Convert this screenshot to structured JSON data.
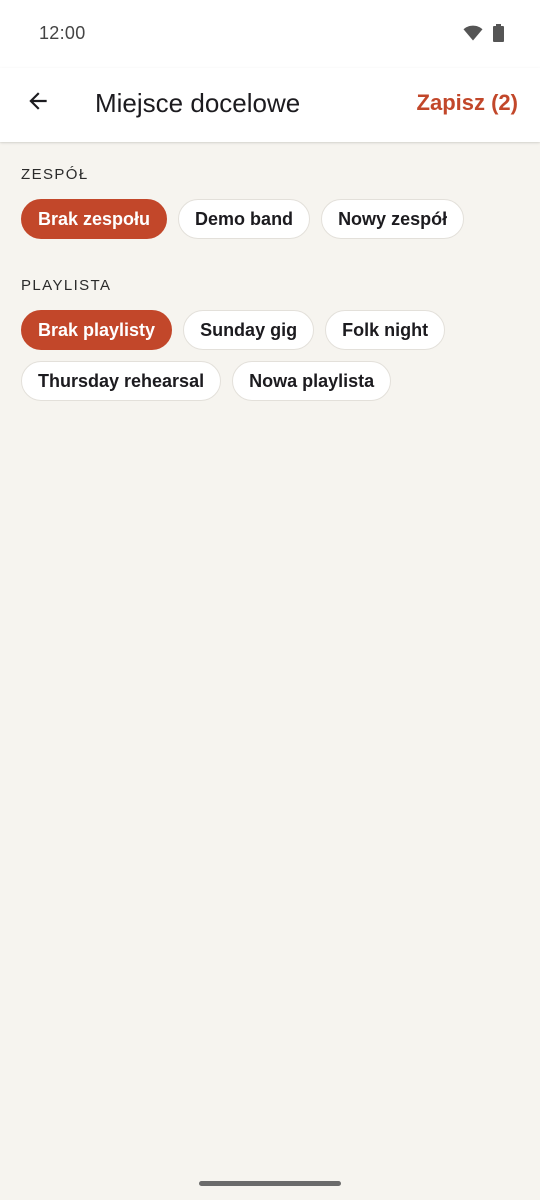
{
  "status_bar": {
    "time": "12:00",
    "icons": [
      "wifi-icon",
      "battery-icon"
    ]
  },
  "app_bar": {
    "back_icon": "arrow-left-icon",
    "title": "Miejsce docelowe",
    "save_label": "Zapisz (2)"
  },
  "colors": {
    "accent": "#c2472a",
    "background": "#f6f4ef",
    "surface": "#ffffff"
  },
  "sections": {
    "band": {
      "label": "ZESPÓŁ",
      "chips": [
        {
          "label": "Brak zespołu",
          "selected": true
        },
        {
          "label": "Demo band",
          "selected": false
        },
        {
          "label": "Nowy zespół",
          "selected": false
        }
      ]
    },
    "playlist": {
      "label": "PLAYLISTA",
      "chips": [
        {
          "label": "Brak playlisty",
          "selected": true
        },
        {
          "label": "Sunday gig",
          "selected": false
        },
        {
          "label": "Folk night",
          "selected": false
        },
        {
          "label": "Thursday rehearsal",
          "selected": false
        },
        {
          "label": "Nowa playlista",
          "selected": false
        }
      ]
    }
  }
}
